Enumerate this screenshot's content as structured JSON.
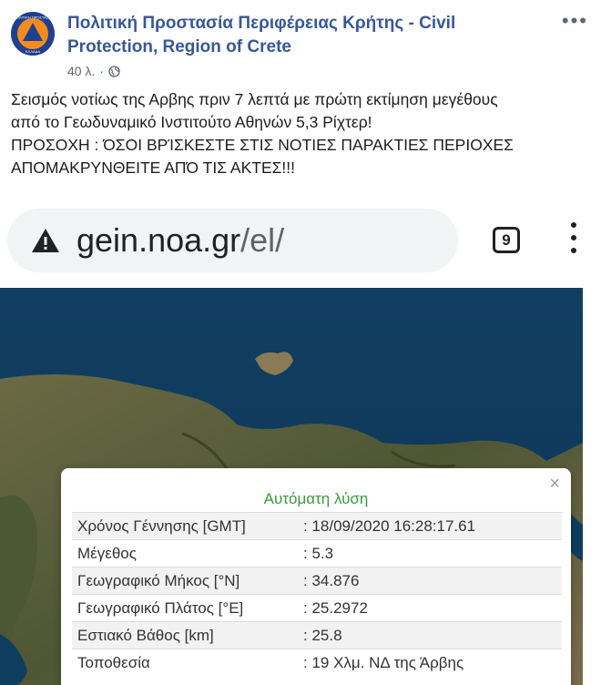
{
  "post": {
    "page_name": "Πολιτική Προστασία Περιφέρειας Κρήτης - Civil Protection, Region of Crete",
    "time": "40 λ.",
    "separator": "·",
    "lines": [
      "Σεισμός νοτίως της Αρβης πριν 7 λεπτά με πρώτη εκτίμηση μεγέθους",
      "από το Γεωδυναμικό Ινστιτούτο Αθηνών 5,3 Ρίχτερ!",
      "ΠΡΟΣΟΧΗ : ΌΣΟΙ ΒΡΊΣΚΕΣΤΕ ΣΤΙΣ ΝΟΤΙΕΣ ΠΑΡΑΚΤΙΕΣ ΠΕΡΙΟΧΕΣ",
      "ΑΠΟΜΑΚΡΥΝΘΕΙΤΕ ΑΠΌ ΤΙΣ ΑΚΤΕΣ!!!"
    ],
    "more_label": "•••",
    "avatar_lines": [
      "ΠΟΛΙΤΙΚΗ ΠΡΟΣΤΑΣΙΑ",
      "ΕΛΛΑΔΑ"
    ]
  },
  "browser": {
    "url_host": "gein.noa.gr",
    "url_path": "/el/",
    "tab_count": "9"
  },
  "popup": {
    "close": "×",
    "title": "Αυτόματη λύση",
    "rows": [
      {
        "label": "Χρόνος Γέννησης [GMT]",
        "value": ": 18/09/2020 16:28:17.61"
      },
      {
        "label": "Μέγεθος",
        "value": ": 5.3"
      },
      {
        "label": "Γεωγραφικό Μήκος [°N]",
        "value": ": 34.876"
      },
      {
        "label": "Γεωγραφικό Πλάτος [°E]",
        "value": ": 25.2972"
      },
      {
        "label": "Εστιακό Βάθος [km]",
        "value": ": 25.8"
      },
      {
        "label": "Τοποθεσία",
        "value": ": 19 Χλμ. ΝΔ της Άρβης"
      }
    ]
  },
  "colors": {
    "page_name": "#385898",
    "popup_title": "#3a9a3a",
    "sea": "#0f3d5f",
    "land": "#5a5a3a"
  }
}
